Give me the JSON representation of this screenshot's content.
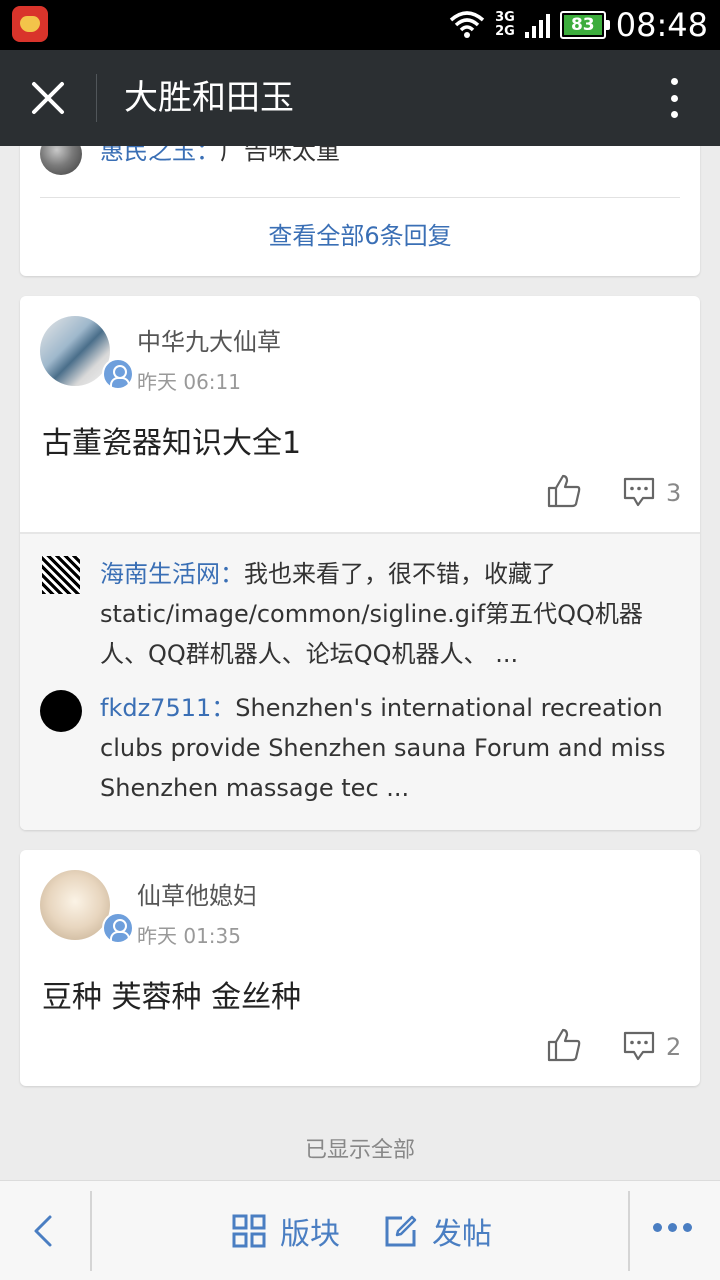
{
  "status_bar": {
    "network_top": "3G",
    "network_bottom": "2G",
    "battery": "83",
    "time": "08:48"
  },
  "header": {
    "title": "大胜和田玉"
  },
  "card0": {
    "partial_reply": {
      "author": "惠民之玉：",
      "text": "广告味太重"
    },
    "view_all": "查看全部6条回复"
  },
  "posts": [
    {
      "author": "中华九大仙草",
      "time": "昨天 06:11",
      "title": "古董瓷器知识大全1",
      "comment_count": "3",
      "replies": [
        {
          "author": "海南生活网：",
          "text": "我也来看了，很不错，收藏了static/image/common/sigline.gif第五代QQ机器人、QQ群机器人、论坛QQ机器人、 ..."
        },
        {
          "author": "fkdz7511：",
          "text": "Shenzhen's international recreation clubs provide Shenzhen sauna Forum and miss Shenzhen massage tec ..."
        }
      ]
    },
    {
      "author": "仙草他媳妇",
      "time": "昨天 01:35",
      "title": "豆种 芙蓉种 金丝种",
      "comment_count": "2"
    }
  ],
  "footer_text": "已显示全部",
  "bottom_bar": {
    "sections_label": "版块",
    "post_label": "发帖"
  },
  "colors": {
    "title_bar": "#2b2f32",
    "link_blue": "#3a6fb5",
    "accent_blue": "#4a7ec2",
    "battery_green": "#3cad3c"
  }
}
